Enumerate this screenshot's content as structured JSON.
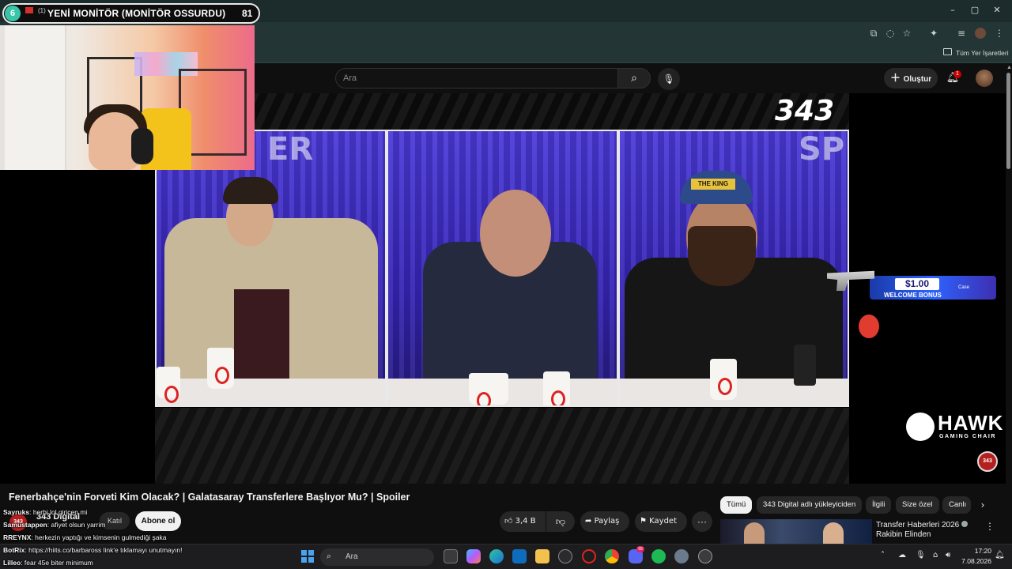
{
  "browser": {
    "bookmarks_label": "Tüm Yer İşaretleri",
    "window_controls": {
      "minimize": "–",
      "maximize": "▢",
      "close": "✕"
    }
  },
  "stream_overlay": {
    "badge_number": "6",
    "small_count": "(1)",
    "title": "YENİ MONİTÖR (MONİTÖR OSSURDU)",
    "viewers": "81"
  },
  "youtube": {
    "search_placeholder": "Ara",
    "create_label": "Oluştur",
    "notification_count": "1",
    "video_title": "Fenerbahçe'nin Forveti Kim Olacak? | Galatasaray Transferlere Başlıyor Mu? | Spoiler",
    "channel": {
      "avatar_text": "343",
      "name": "343 Digital",
      "join_label": "Katıl",
      "subscribe_label": "Abone ol"
    },
    "actions": {
      "like_count": "3,4 B",
      "share_label": "Paylaş",
      "save_label": "Kaydet",
      "more_label": "···"
    },
    "chips": [
      "Tümü",
      "343 Digital adlı yükleyiciden",
      "İlgili",
      "Size özel",
      "Canlı"
    ],
    "related": {
      "title_line1": "Transfer Haberleri 2026",
      "title_line2": "Rakibin Elinden"
    }
  },
  "video_overlays": {
    "logo_text": "343",
    "panel_watermarks": [
      "ER",
      "",
      "SP"
    ],
    "cap_text": "THE KING",
    "bonus_amount": "$1.00",
    "bonus_text": "WELCOME BONUS",
    "bonus_brand": "Case",
    "sponsor_name": "HAWK",
    "sponsor_sub": "GAMING CHAIR",
    "corner_badge": "343"
  },
  "chat": [
    {
      "user": "Sayruks",
      "message": ": herbi lol giricen mi",
      "color": "#f5f5f5"
    },
    {
      "user": "Samustappen",
      "message": ": afiyet olsun yarrim",
      "color": "#f5f5f5"
    },
    {
      "user": "RREYNX",
      "message": ": herkezin yaptığı ve kimsenin gulmediği şaka",
      "color": "#f5f5f5"
    },
    {
      "user": "BotRix",
      "message": ": https://hiits.co/barbaross link'e tıklamayı unutmayın!",
      "color": "#f5f5f5"
    },
    {
      "user": "Lilleo",
      "message": ": fear 45e biter minimum",
      "color": "#f5f5f5"
    }
  ],
  "taskbar": {
    "search_placeholder": "Ara",
    "time": "17:20",
    "date": "7.08.2026",
    "discord_badge": "99"
  },
  "colors": {
    "accent_red": "#cc0000",
    "panel_blue": "#3b2bc4",
    "chrome_bg": "#233534"
  }
}
